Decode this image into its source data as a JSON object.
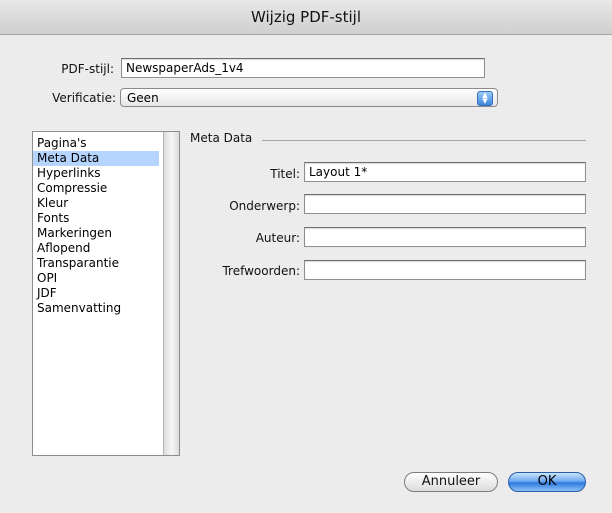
{
  "window": {
    "title": "Wijzig PDF-stijl"
  },
  "form": {
    "pdf_stijl_label": "PDF-stijl:",
    "pdf_stijl_value": "NewspaperAds_1v4",
    "verificatie_label": "Verificatie:",
    "verificatie_value": "Geen"
  },
  "sidebar": {
    "items": [
      {
        "label": "Pagina's",
        "selected": false
      },
      {
        "label": "Meta Data",
        "selected": true
      },
      {
        "label": "Hyperlinks",
        "selected": false
      },
      {
        "label": "Compressie",
        "selected": false
      },
      {
        "label": "Kleur",
        "selected": false
      },
      {
        "label": "Fonts",
        "selected": false
      },
      {
        "label": "Markeringen",
        "selected": false
      },
      {
        "label": "Aflopend",
        "selected": false
      },
      {
        "label": "Transparantie",
        "selected": false
      },
      {
        "label": "OPI",
        "selected": false
      },
      {
        "label": "JDF",
        "selected": false
      },
      {
        "label": "Samenvatting",
        "selected": false
      }
    ]
  },
  "metadata": {
    "group_title": "Meta Data",
    "titel_label": "Titel:",
    "titel_value": "Layout 1*",
    "onderwerp_label": "Onderwerp:",
    "onderwerp_value": "",
    "auteur_label": "Auteur:",
    "auteur_value": "",
    "trefwoorden_label": "Trefwoorden:",
    "trefwoorden_value": ""
  },
  "buttons": {
    "cancel_label": "Annuleer",
    "ok_label": "OK"
  },
  "icons": {
    "popup_stepper": "up-down-arrows-icon"
  },
  "colors": {
    "selection": "#b5d5ff",
    "default_button": "#2d7ae0"
  }
}
